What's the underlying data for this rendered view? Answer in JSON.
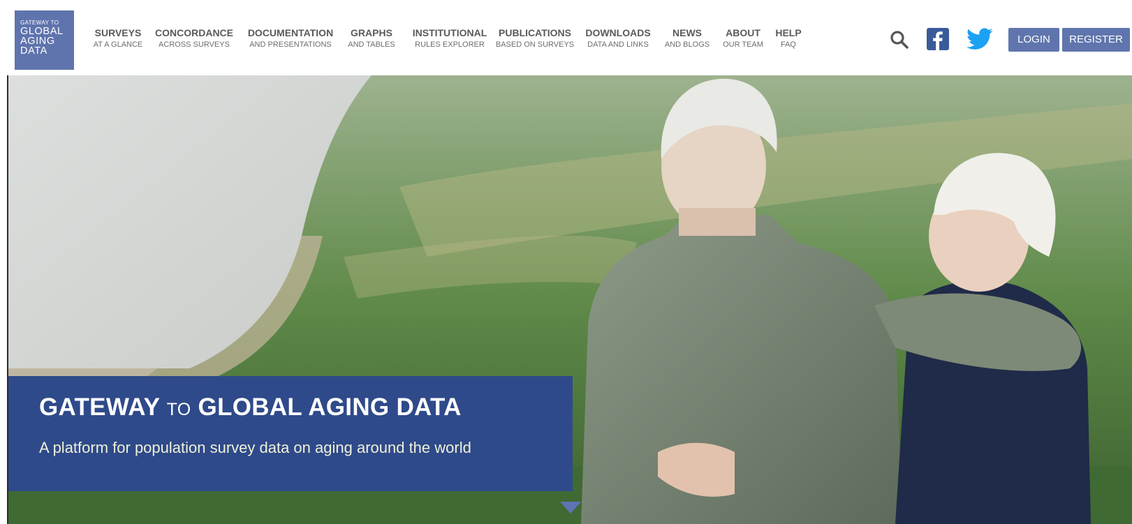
{
  "logo": {
    "line1": "GATEWAY TO",
    "line2": "GLOBAL",
    "line3": "AGING",
    "line4": "DATA"
  },
  "nav": [
    {
      "main": "SURVEYS",
      "sub": "AT A GLANCE"
    },
    {
      "main": "CONCORDANCE",
      "sub": "ACROSS SURVEYS"
    },
    {
      "main": "DOCUMENTATION",
      "sub": "AND PRESENTATIONS"
    },
    {
      "main": "GRAPHS",
      "sub": "AND TABLES"
    },
    {
      "main": "INSTITUTIONAL",
      "sub": "RULES EXPLORER"
    },
    {
      "main": "PUBLICATIONS",
      "sub": "BASED ON SURVEYS"
    },
    {
      "main": "DOWNLOADS",
      "sub": "DATA AND LINKS"
    },
    {
      "main": "NEWS",
      "sub": "AND BLOGS"
    },
    {
      "main": "ABOUT",
      "sub": "OUR TEAM"
    },
    {
      "main": "HELP",
      "sub": "FAQ"
    }
  ],
  "icons": {
    "search": "search-icon",
    "facebook": "facebook-icon",
    "twitter": "twitter-icon"
  },
  "auth": {
    "login": "LOGIN",
    "register": "REGISTER"
  },
  "hero": {
    "title_part1": "GATEWAY",
    "title_to": "TO",
    "title_part2": "GLOBAL AGING DATA",
    "subtitle": "A platform for population survey data on aging around the world"
  },
  "colors": {
    "brand": "#5f74ad",
    "hero_box": "#2f4a8a",
    "nav_text": "#5a5a5a",
    "facebook": "#3a5b9a",
    "twitter": "#1da1f2"
  }
}
